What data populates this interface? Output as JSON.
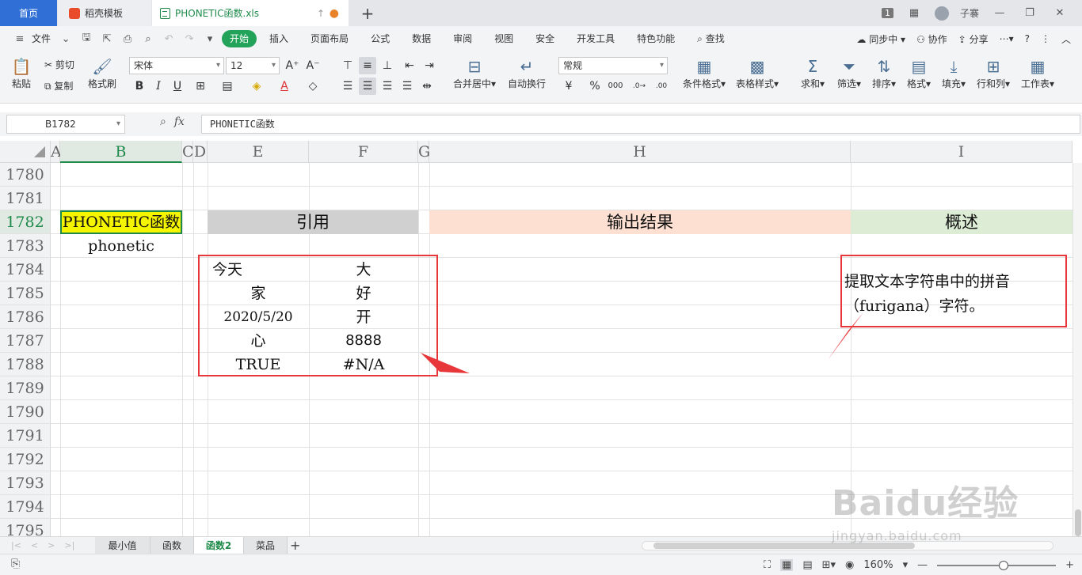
{
  "title_tabs": {
    "home": "首页",
    "template": "稻壳模板",
    "file": "PHONETIC函数.xls",
    "window_count": "1",
    "user": "子褰"
  },
  "menu": {
    "file": "文件",
    "items": [
      "开始",
      "插入",
      "页面布局",
      "公式",
      "数据",
      "审阅",
      "视图",
      "安全",
      "开发工具",
      "特色功能"
    ],
    "search": "查找",
    "sync": "同步中",
    "collab": "协作",
    "share": "分享"
  },
  "ribbon": {
    "paste": "粘贴",
    "cut": "剪切",
    "copy": "复制",
    "format_painter": "格式刷",
    "font_name": "宋体",
    "font_size": "12",
    "merge_center": "合并居中",
    "auto_wrap": "自动换行",
    "number_format": "常规",
    "conditional_format": "条件格式",
    "table_style": "表格样式",
    "sum": "求和",
    "filter": "筛选",
    "sort": "排序",
    "format": "格式",
    "fill": "填充",
    "row_col": "行和列",
    "worksheet": "工作表"
  },
  "formula_bar": {
    "name_box": "B1782",
    "formula": "PHONETIC函数"
  },
  "grid": {
    "columns": [
      "A",
      "B",
      "C",
      "D",
      "E",
      "F",
      "G",
      "H",
      "I"
    ],
    "rows": [
      "1780",
      "1781",
      "1782",
      "1783",
      "1784",
      "1785",
      "1786",
      "1787",
      "1788",
      "1789",
      "1790",
      "1791",
      "1792",
      "1793",
      "1794",
      "1795"
    ],
    "cells": {
      "b1782": "PHONETIC函数",
      "b1783": "phonetic",
      "e1782": "引用",
      "h1782": "输出结果",
      "i1782": "概述",
      "e1784": "今天",
      "f1784": "大",
      "e1785": "家",
      "f1785": "好",
      "e1786": "2020/5/20",
      "f1786": "开",
      "e1787": "心",
      "f1787": "8888",
      "e1788": "TRUE",
      "f1788": "#N/A"
    },
    "note": "提取文本字符串中的拼音（furigana）字符。"
  },
  "sheets": [
    "最小值",
    "函数",
    "函数2",
    "菜品"
  ],
  "active_sheet": "函数2",
  "status": {
    "zoom": "160%"
  },
  "watermark": {
    "main": "Baidu经验",
    "sub": "jingyan.baidu.com"
  },
  "colors": {
    "accent": "#1e8a4a",
    "yellow_cell": "#f5f500",
    "gray_header": "#d0d0d0",
    "peach_header": "#fde0d2",
    "green_header": "#dcecd5",
    "annotation_red": "#e8373a"
  }
}
